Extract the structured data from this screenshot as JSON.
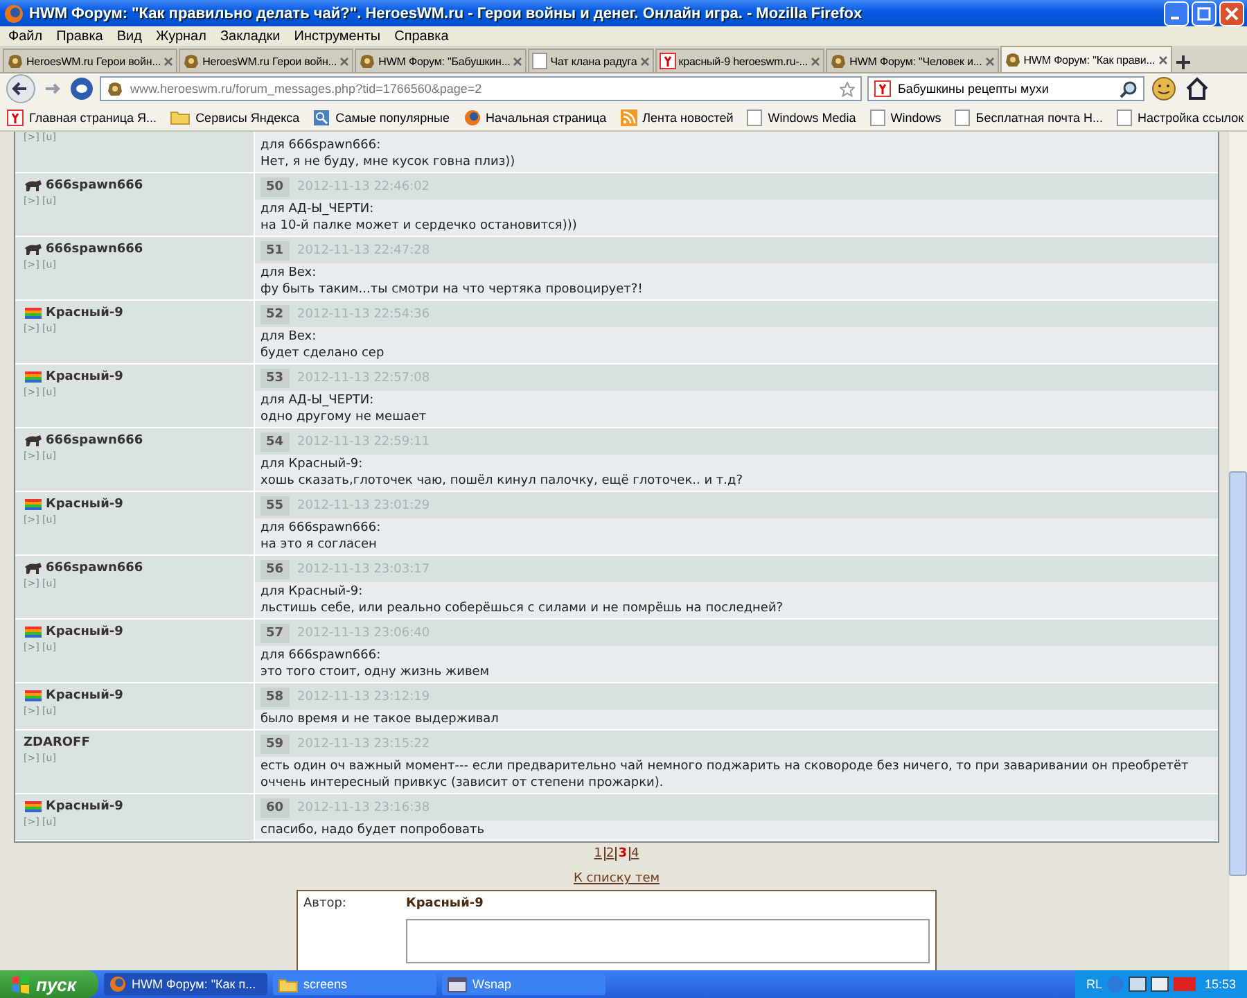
{
  "window": {
    "title": "HWM Форум: \"Как правильно делать чай?\". HeroesWM.ru - Герои войны и денег. Онлайн игра. - Mozilla Firefox"
  },
  "menu": [
    "Файл",
    "Правка",
    "Вид",
    "Журнал",
    "Закладки",
    "Инструменты",
    "Справка"
  ],
  "tabs": [
    {
      "label": "HeroesWM.ru Герои войн...",
      "kind": "site",
      "selected": false
    },
    {
      "label": "HeroesWM.ru Герои войн...",
      "kind": "site",
      "selected": false
    },
    {
      "label": "HWM Форум: \"Бабушкин...",
      "kind": "site",
      "selected": false
    },
    {
      "label": "Чат клана радуга",
      "kind": "blank",
      "selected": false
    },
    {
      "label": "красный-9 heroeswm.ru-...",
      "kind": "yandex",
      "selected": false
    },
    {
      "label": "HWM Форум: \"Человек и...",
      "kind": "site",
      "selected": false
    },
    {
      "label": "HWM Форум: \"Как прави...",
      "kind": "site",
      "selected": true
    }
  ],
  "address": {
    "value": "www.heroeswm.ru/forum_messages.php?tid=1766560&page=2"
  },
  "search": {
    "value": "Бабушкины рецепты мухи"
  },
  "bookmarks": [
    {
      "label": "Главная страница Я...",
      "kind": "yandex"
    },
    {
      "label": "Сервисы Яндекса",
      "kind": "folder"
    },
    {
      "label": "Самые популярные",
      "kind": "popular"
    },
    {
      "label": "Начальная страница",
      "kind": "firefox"
    },
    {
      "label": "Лента новостей",
      "kind": "rss"
    },
    {
      "label": "Windows Media",
      "kind": "blank"
    },
    {
      "label": "Windows",
      "kind": "blank"
    },
    {
      "label": "Бесплатная почта Н...",
      "kind": "blank"
    },
    {
      "label": "Настройка ссылок",
      "kind": "blank"
    }
  ],
  "posts": [
    {
      "kind": "partial",
      "author_links": "[>] [u]",
      "body": [
        "для 666spawn666:",
        "Нет, я не буду, мне кусок говна плиз))"
      ]
    },
    {
      "kind": "beast",
      "author": "666spawn666",
      "author_links": "[>] [u]",
      "number": "50",
      "date": "2012-11-13 22:46:02",
      "body": [
        "для АД-Ы_ЧЕРТИ:",
        "на 10-й палке может и сердечко остановится)))"
      ]
    },
    {
      "kind": "beast",
      "author": "666spawn666",
      "author_links": "[>] [u]",
      "number": "51",
      "date": "2012-11-13 22:47:28",
      "body": [
        "для Bex:",
        "фу быть таким...ты смотри на что чертяка провоцирует?!"
      ]
    },
    {
      "kind": "flag",
      "author": "Красный-9",
      "author_links": "[>] [u]",
      "number": "52",
      "date": "2012-11-13 22:54:36",
      "body": [
        "для Bex:",
        "будет сделано сер"
      ]
    },
    {
      "kind": "flag",
      "author": "Красный-9",
      "author_links": "[>] [u]",
      "number": "53",
      "date": "2012-11-13 22:57:08",
      "body": [
        "для АД-Ы_ЧЕРТИ:",
        "одно другому не мешает"
      ]
    },
    {
      "kind": "beast",
      "author": "666spawn666",
      "author_links": "[>] [u]",
      "number": "54",
      "date": "2012-11-13 22:59:11",
      "body": [
        "для Красный-9:",
        "хошь сказать,глоточек чаю, пошёл кинул палочку, ещё глоточек.. и т.д?"
      ]
    },
    {
      "kind": "flag",
      "author": "Красный-9",
      "author_links": "[>] [u]",
      "number": "55",
      "date": "2012-11-13 23:01:29",
      "body": [
        "для 666spawn666:",
        "на это я согласен"
      ]
    },
    {
      "kind": "beast",
      "author": "666spawn666",
      "author_links": "[>] [u]",
      "number": "56",
      "date": "2012-11-13 23:03:17",
      "body": [
        "для Красный-9:",
        "льстишь себе, или реально соберёшься с силами и не помрёшь на последней?"
      ]
    },
    {
      "kind": "flag",
      "author": "Красный-9",
      "author_links": "[>] [u]",
      "number": "57",
      "date": "2012-11-13 23:06:40",
      "body": [
        "для 666spawn666:",
        "это того стоит, одну жизнь живем"
      ]
    },
    {
      "kind": "flag",
      "author": "Красный-9",
      "author_links": "[>] [u]",
      "number": "58",
      "date": "2012-11-13 23:12:19",
      "body": [
        "было время и не такое выдерживал"
      ]
    },
    {
      "kind": "plain",
      "author": "ZDAROFF",
      "author_links": "[>] [u]",
      "number": "59",
      "date": "2012-11-13 23:15:22",
      "body": [
        "есть один оч важный момент--- если предварительно чай немного поджарить на сковороде без ничего, то при заваривании он преобретёт оччень интересный привкус (зависит от степени прожарки)."
      ]
    },
    {
      "kind": "flag",
      "author": "Красный-9",
      "author_links": "[>] [u]",
      "number": "60",
      "date": "2012-11-13 23:16:38",
      "body": [
        "спасибо, надо будет попробовать"
      ]
    }
  ],
  "pages": [
    {
      "label": "1",
      "selected": false
    },
    {
      "label": "2",
      "selected": false
    },
    {
      "label": "3",
      "selected": true
    },
    {
      "label": "4",
      "selected": false
    }
  ],
  "back_link": "К списку тем",
  "reply_form": {
    "author_label": "Автор:",
    "author": "Красный-9"
  },
  "taskbar": {
    "start": "пуск",
    "items": [
      {
        "label": "HWM Форум: \"Как п...",
        "kind": "firefox",
        "selected": true
      },
      {
        "label": "screens",
        "kind": "folder",
        "selected": false
      },
      {
        "label": "Wsnap",
        "kind": "app",
        "selected": false
      }
    ],
    "language": "RL",
    "clock": "15:53"
  }
}
